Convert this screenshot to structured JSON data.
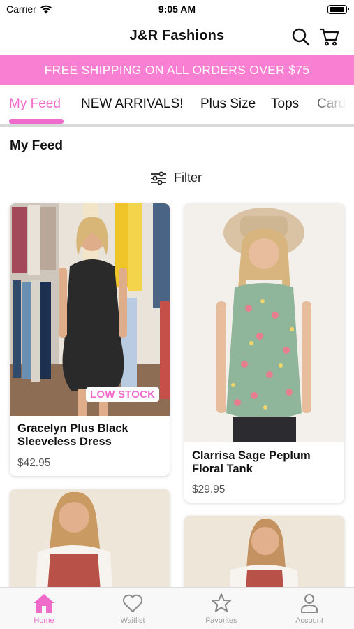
{
  "status_bar": {
    "carrier": "Carrier",
    "time": "9:05 AM"
  },
  "header": {
    "title": "J&R Fashions"
  },
  "promo": {
    "text": "FREE SHIPPING ON ALL ORDERS OVER $75"
  },
  "tabs": [
    {
      "label": "My Feed"
    },
    {
      "label": "NEW ARRIVALS!"
    },
    {
      "label": "Plus Size"
    },
    {
      "label": "Tops"
    },
    {
      "label": "Card"
    }
  ],
  "feed": {
    "title": "My Feed",
    "filter_label": "Filter"
  },
  "products": [
    {
      "name": "Gracelyn Plus Black Sleeveless Dress",
      "price": "$42.95",
      "badge": "LOW STOCK"
    },
    {
      "name": "Clarrisa Sage Peplum Floral Tank",
      "price": "$29.95"
    }
  ],
  "bottom_nav": [
    {
      "label": "Home",
      "icon": "home-icon"
    },
    {
      "label": "Waitlist",
      "icon": "heart-icon"
    },
    {
      "label": "Favorites",
      "icon": "star-icon"
    },
    {
      "label": "Account",
      "icon": "person-icon"
    }
  ],
  "colors": {
    "accent": "#f06ccb",
    "promo_bg": "#f97fd2"
  }
}
